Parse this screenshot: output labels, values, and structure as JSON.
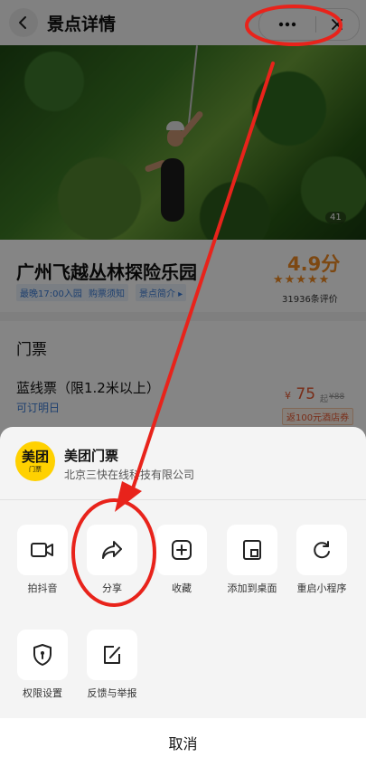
{
  "header": {
    "title": "景点详情"
  },
  "hero": {
    "photo_count": "41"
  },
  "attraction": {
    "name": "广州飞越丛林探险乐园",
    "tags": [
      "最晚17:00入园",
      "购票须知",
      "景点简介 ▸"
    ],
    "score": "4.9分",
    "stars": "★★★★★",
    "reviews": "31936条评价"
  },
  "tickets": {
    "title": "门票",
    "item": {
      "name": "蓝线票（限1.2米以上）",
      "bookable": "可订明日",
      "price_currency": "¥",
      "price": "75",
      "price_from": "起",
      "original": "¥88",
      "coupon": "返100元酒店券"
    }
  },
  "sheet": {
    "logo_main": "美团",
    "logo_sub": "门票",
    "app_name": "美团门票",
    "app_company": "北京三快在线科技有限公司",
    "actions": [
      {
        "label": "拍抖音",
        "icon": "video-camera-icon"
      },
      {
        "label": "分享",
        "icon": "share-arrow-icon"
      },
      {
        "label": "收藏",
        "icon": "add-favorite-icon"
      },
      {
        "label": "添加到桌面",
        "icon": "add-to-desktop-icon"
      },
      {
        "label": "重启小程序",
        "icon": "restart-icon"
      },
      {
        "label": "权限设置",
        "icon": "permission-shield-icon"
      },
      {
        "label": "反馈与举报",
        "icon": "feedback-edit-icon"
      }
    ],
    "cancel": "取消"
  },
  "annotation_color": "#e8231b"
}
